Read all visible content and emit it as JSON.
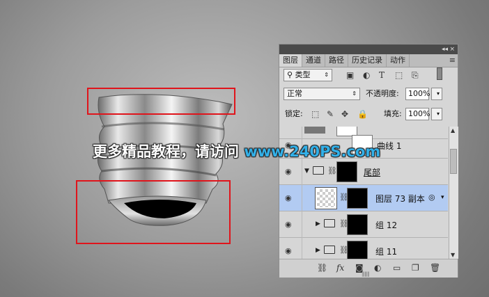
{
  "watermark": {
    "prefix": "更多精品教程，请访问 ",
    "url": "www.240PS.com"
  },
  "panel": {
    "top_collapse": "◂◂",
    "top_close": "×",
    "tabs": [
      "图层",
      "通道",
      "路径",
      "历史记录",
      "动作"
    ],
    "active_tab": "图层",
    "menu_icon": "≡",
    "filter": {
      "search_icon": "⚲",
      "label": "类型",
      "icons": [
        "image-filter-icon",
        "adjustment-filter-icon",
        "type-filter-icon",
        "shape-filter-icon",
        "smart-object-filter-icon"
      ]
    },
    "blend_mode": "正常",
    "opacity_label": "不透明度:",
    "opacity_value": "100%",
    "lock_label": "锁定:",
    "fill_label": "填充:",
    "fill_value": "100%",
    "layers": [
      {
        "name": "",
        "type": "partial"
      },
      {
        "name": "曲线 1",
        "type": "adjustment"
      },
      {
        "name": "尾部",
        "type": "group",
        "expanded": true
      },
      {
        "name": "图层 73 副本",
        "type": "layer",
        "selected": true
      },
      {
        "name": "组 12",
        "type": "group",
        "expanded": false
      },
      {
        "name": "组 11",
        "type": "group",
        "expanded": false
      }
    ],
    "bottom_icons": [
      "link-icon",
      "fx-icon",
      "mask-icon",
      "adjustment-icon",
      "new-group-icon",
      "new-layer-icon",
      "delete-icon"
    ],
    "fx_label": "fx"
  },
  "colors": {
    "selection": "#b2cbf2",
    "redbox": "#e0141b",
    "url": "#32b0e8"
  }
}
